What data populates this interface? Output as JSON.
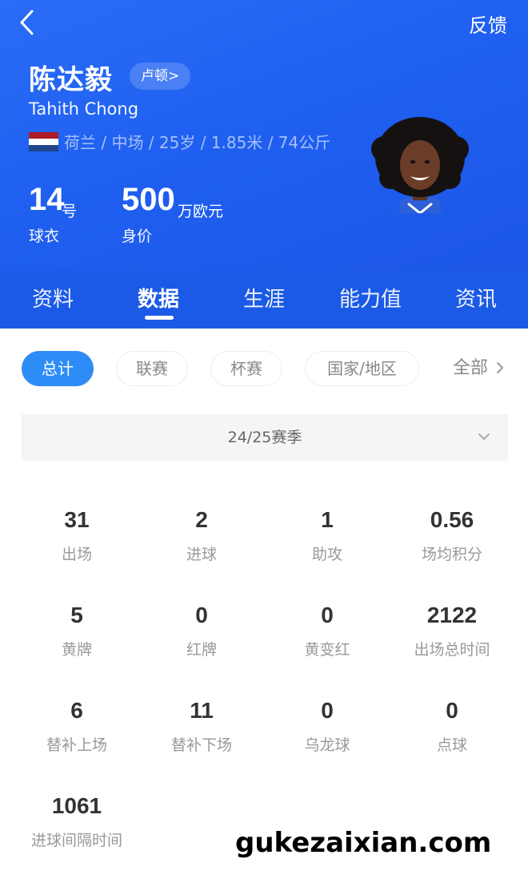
{
  "header": {
    "feedback": "反馈",
    "player_name": "陈达毅",
    "club": "卢顿>",
    "english_name": "Tahith Chong",
    "info": "荷兰 / 中场 / 25岁 / 1.85米 / 74公斤",
    "shirt_number": "14",
    "shirt_unit": "号",
    "shirt_label": "球衣",
    "value_number": "500",
    "value_unit": "万欧元",
    "value_label": "身价",
    "flag_colors": [
      "#ae1c28",
      "#ffffff",
      "#21468b"
    ]
  },
  "tabs": [
    {
      "label": "资料"
    },
    {
      "label": "数据"
    },
    {
      "label": "生涯"
    },
    {
      "label": "能力值"
    },
    {
      "label": "资讯"
    }
  ],
  "filters": {
    "chips": [
      {
        "label": "总计"
      },
      {
        "label": "联赛"
      },
      {
        "label": "杯赛"
      },
      {
        "label": "国家/地区"
      }
    ],
    "more": "全部"
  },
  "season": {
    "selected": "24/25赛季"
  },
  "stats": [
    {
      "value": "31",
      "label": "出场"
    },
    {
      "value": "2",
      "label": "进球"
    },
    {
      "value": "1",
      "label": "助攻"
    },
    {
      "value": "0.56",
      "label": "场均积分"
    },
    {
      "value": "5",
      "label": "黄牌"
    },
    {
      "value": "0",
      "label": "红牌"
    },
    {
      "value": "0",
      "label": "黄变红"
    },
    {
      "value": "2122",
      "label": "出场总时间"
    },
    {
      "value": "6",
      "label": "替补上场"
    },
    {
      "value": "11",
      "label": "替补下场"
    },
    {
      "value": "0",
      "label": "乌龙球"
    },
    {
      "value": "0",
      "label": "点球"
    },
    {
      "value": "1061",
      "label": "进球间隔时间"
    }
  ],
  "watermark": "gukezaixian.com",
  "colors": {
    "header_blue": "#1f5ff0",
    "accent_chip": "#2e8cf6"
  }
}
